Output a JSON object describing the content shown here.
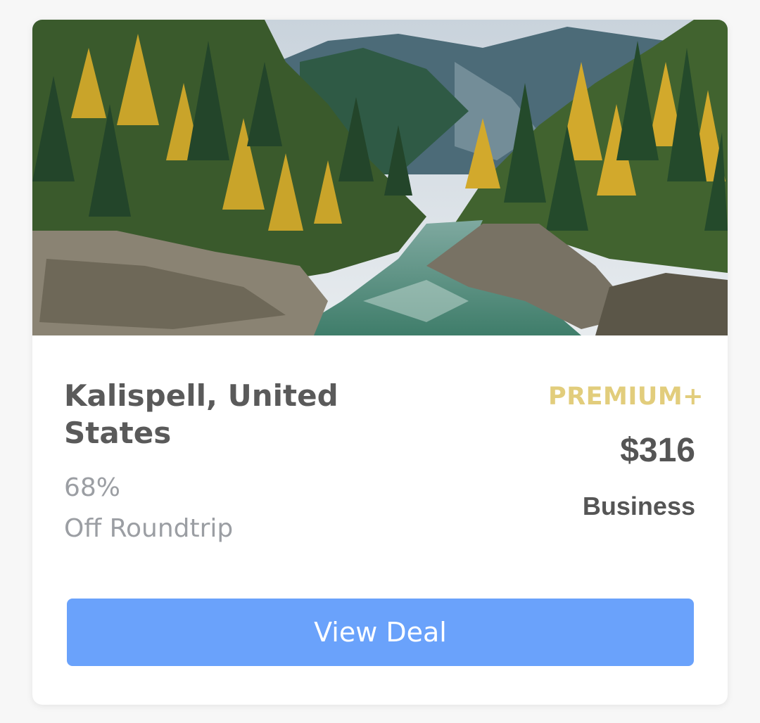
{
  "deal": {
    "image": {
      "icon": "mountain-river-forest-photo"
    },
    "destination": "Kalispell, United States",
    "discount_percent": "68%",
    "discount_text": "Off Roundtrip",
    "badge": "PREMIUM+",
    "price": "$316",
    "cabin": "Business",
    "cta_label": "View Deal"
  },
  "colors": {
    "badge": "#e2cd7c",
    "cta": "#6aa2fb",
    "title": "#5a5a5a",
    "muted": "#9b9ea3"
  }
}
